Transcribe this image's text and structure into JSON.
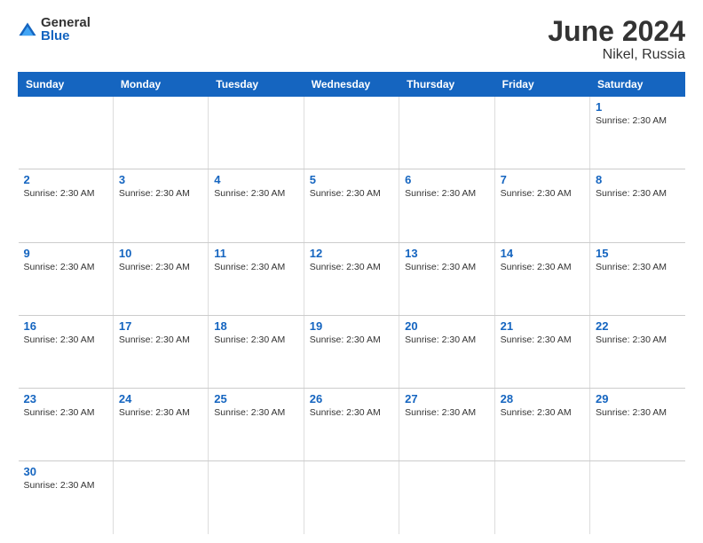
{
  "logo": {
    "general": "General",
    "blue": "Blue"
  },
  "title": "June 2024",
  "subtitle": "Nikel, Russia",
  "days_of_week": [
    "Sunday",
    "Monday",
    "Tuesday",
    "Wednesday",
    "Thursday",
    "Friday",
    "Saturday"
  ],
  "sunrise_text": "Sunrise: 2:30 AM",
  "weeks": [
    {
      "days": [
        {
          "num": "",
          "empty": true
        },
        {
          "num": "",
          "empty": true
        },
        {
          "num": "",
          "empty": true
        },
        {
          "num": "",
          "empty": true
        },
        {
          "num": "",
          "empty": true
        },
        {
          "num": "",
          "empty": true
        },
        {
          "num": "1",
          "sunrise": "Sunrise: 2:30 AM"
        }
      ]
    },
    {
      "days": [
        {
          "num": "2",
          "sunrise": "Sunrise: 2:30 AM"
        },
        {
          "num": "3",
          "sunrise": "Sunrise: 2:30 AM"
        },
        {
          "num": "4",
          "sunrise": "Sunrise: 2:30 AM"
        },
        {
          "num": "5",
          "sunrise": "Sunrise: 2:30 AM"
        },
        {
          "num": "6",
          "sunrise": "Sunrise: 2:30 AM"
        },
        {
          "num": "7",
          "sunrise": "Sunrise: 2:30 AM"
        },
        {
          "num": "8",
          "sunrise": "Sunrise: 2:30 AM"
        }
      ]
    },
    {
      "days": [
        {
          "num": "9",
          "sunrise": "Sunrise: 2:30 AM"
        },
        {
          "num": "10",
          "sunrise": "Sunrise: 2:30 AM"
        },
        {
          "num": "11",
          "sunrise": "Sunrise: 2:30 AM"
        },
        {
          "num": "12",
          "sunrise": "Sunrise: 2:30 AM"
        },
        {
          "num": "13",
          "sunrise": "Sunrise: 2:30 AM"
        },
        {
          "num": "14",
          "sunrise": "Sunrise: 2:30 AM"
        },
        {
          "num": "15",
          "sunrise": "Sunrise: 2:30 AM"
        }
      ]
    },
    {
      "days": [
        {
          "num": "16",
          "sunrise": "Sunrise: 2:30 AM"
        },
        {
          "num": "17",
          "sunrise": "Sunrise: 2:30 AM"
        },
        {
          "num": "18",
          "sunrise": "Sunrise: 2:30 AM"
        },
        {
          "num": "19",
          "sunrise": "Sunrise: 2:30 AM"
        },
        {
          "num": "20",
          "sunrise": "Sunrise: 2:30 AM"
        },
        {
          "num": "21",
          "sunrise": "Sunrise: 2:30 AM"
        },
        {
          "num": "22",
          "sunrise": "Sunrise: 2:30 AM"
        }
      ]
    },
    {
      "days": [
        {
          "num": "23",
          "sunrise": "Sunrise: 2:30 AM"
        },
        {
          "num": "24",
          "sunrise": "Sunrise: 2:30 AM"
        },
        {
          "num": "25",
          "sunrise": "Sunrise: 2:30 AM"
        },
        {
          "num": "26",
          "sunrise": "Sunrise: 2:30 AM"
        },
        {
          "num": "27",
          "sunrise": "Sunrise: 2:30 AM"
        },
        {
          "num": "28",
          "sunrise": "Sunrise: 2:30 AM"
        },
        {
          "num": "29",
          "sunrise": "Sunrise: 2:30 AM"
        }
      ]
    },
    {
      "days": [
        {
          "num": "30",
          "sunrise": "Sunrise: 2:30 AM"
        },
        {
          "num": "",
          "empty": true
        },
        {
          "num": "",
          "empty": true
        },
        {
          "num": "",
          "empty": true
        },
        {
          "num": "",
          "empty": true
        },
        {
          "num": "",
          "empty": true
        },
        {
          "num": "",
          "empty": true
        }
      ]
    }
  ]
}
